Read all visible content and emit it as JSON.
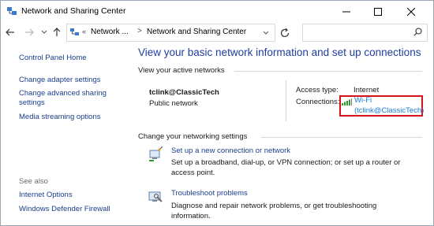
{
  "window": {
    "title": "Network and Sharing Center"
  },
  "address": {
    "chevron": "«",
    "crumbs": [
      "Network ...",
      "Network and Sharing Center"
    ],
    "separator": ">",
    "search_placeholder": ""
  },
  "sidebar": {
    "home": "Control Panel Home",
    "items": [
      "Change adapter settings",
      "Change advanced sharing settings",
      "Media streaming options"
    ],
    "see_also_label": "See also",
    "see_also": [
      "Internet Options",
      "Windows Defender Firewall"
    ]
  },
  "main": {
    "title": "View your basic network information and set up connections",
    "active_networks_label": "View your active networks",
    "network": {
      "name": "tclink@ClassicTech",
      "type": "Public network"
    },
    "access_type_label": "Access type:",
    "access_type_value": "Internet",
    "connections_label": "Connections:",
    "connection_line1": "Wi-Fi",
    "connection_line2": "(tclink@ClassicTech)",
    "change_settings_label": "Change your networking settings",
    "tasks": [
      {
        "link": "Set up a new connection or network",
        "description": "Set up a broadband, dial-up, or VPN connection; or set up a router or access point.",
        "icon": "new-connection-icon"
      },
      {
        "link": "Troubleshoot problems",
        "description": "Diagnose and repair network problems, or get troubleshooting information.",
        "icon": "troubleshoot-icon"
      }
    ]
  },
  "colors": {
    "link": "#1a3e8c",
    "title": "#1e3f9c",
    "wifi_link": "#1a7dd6",
    "highlight_box": "#d7141c"
  }
}
